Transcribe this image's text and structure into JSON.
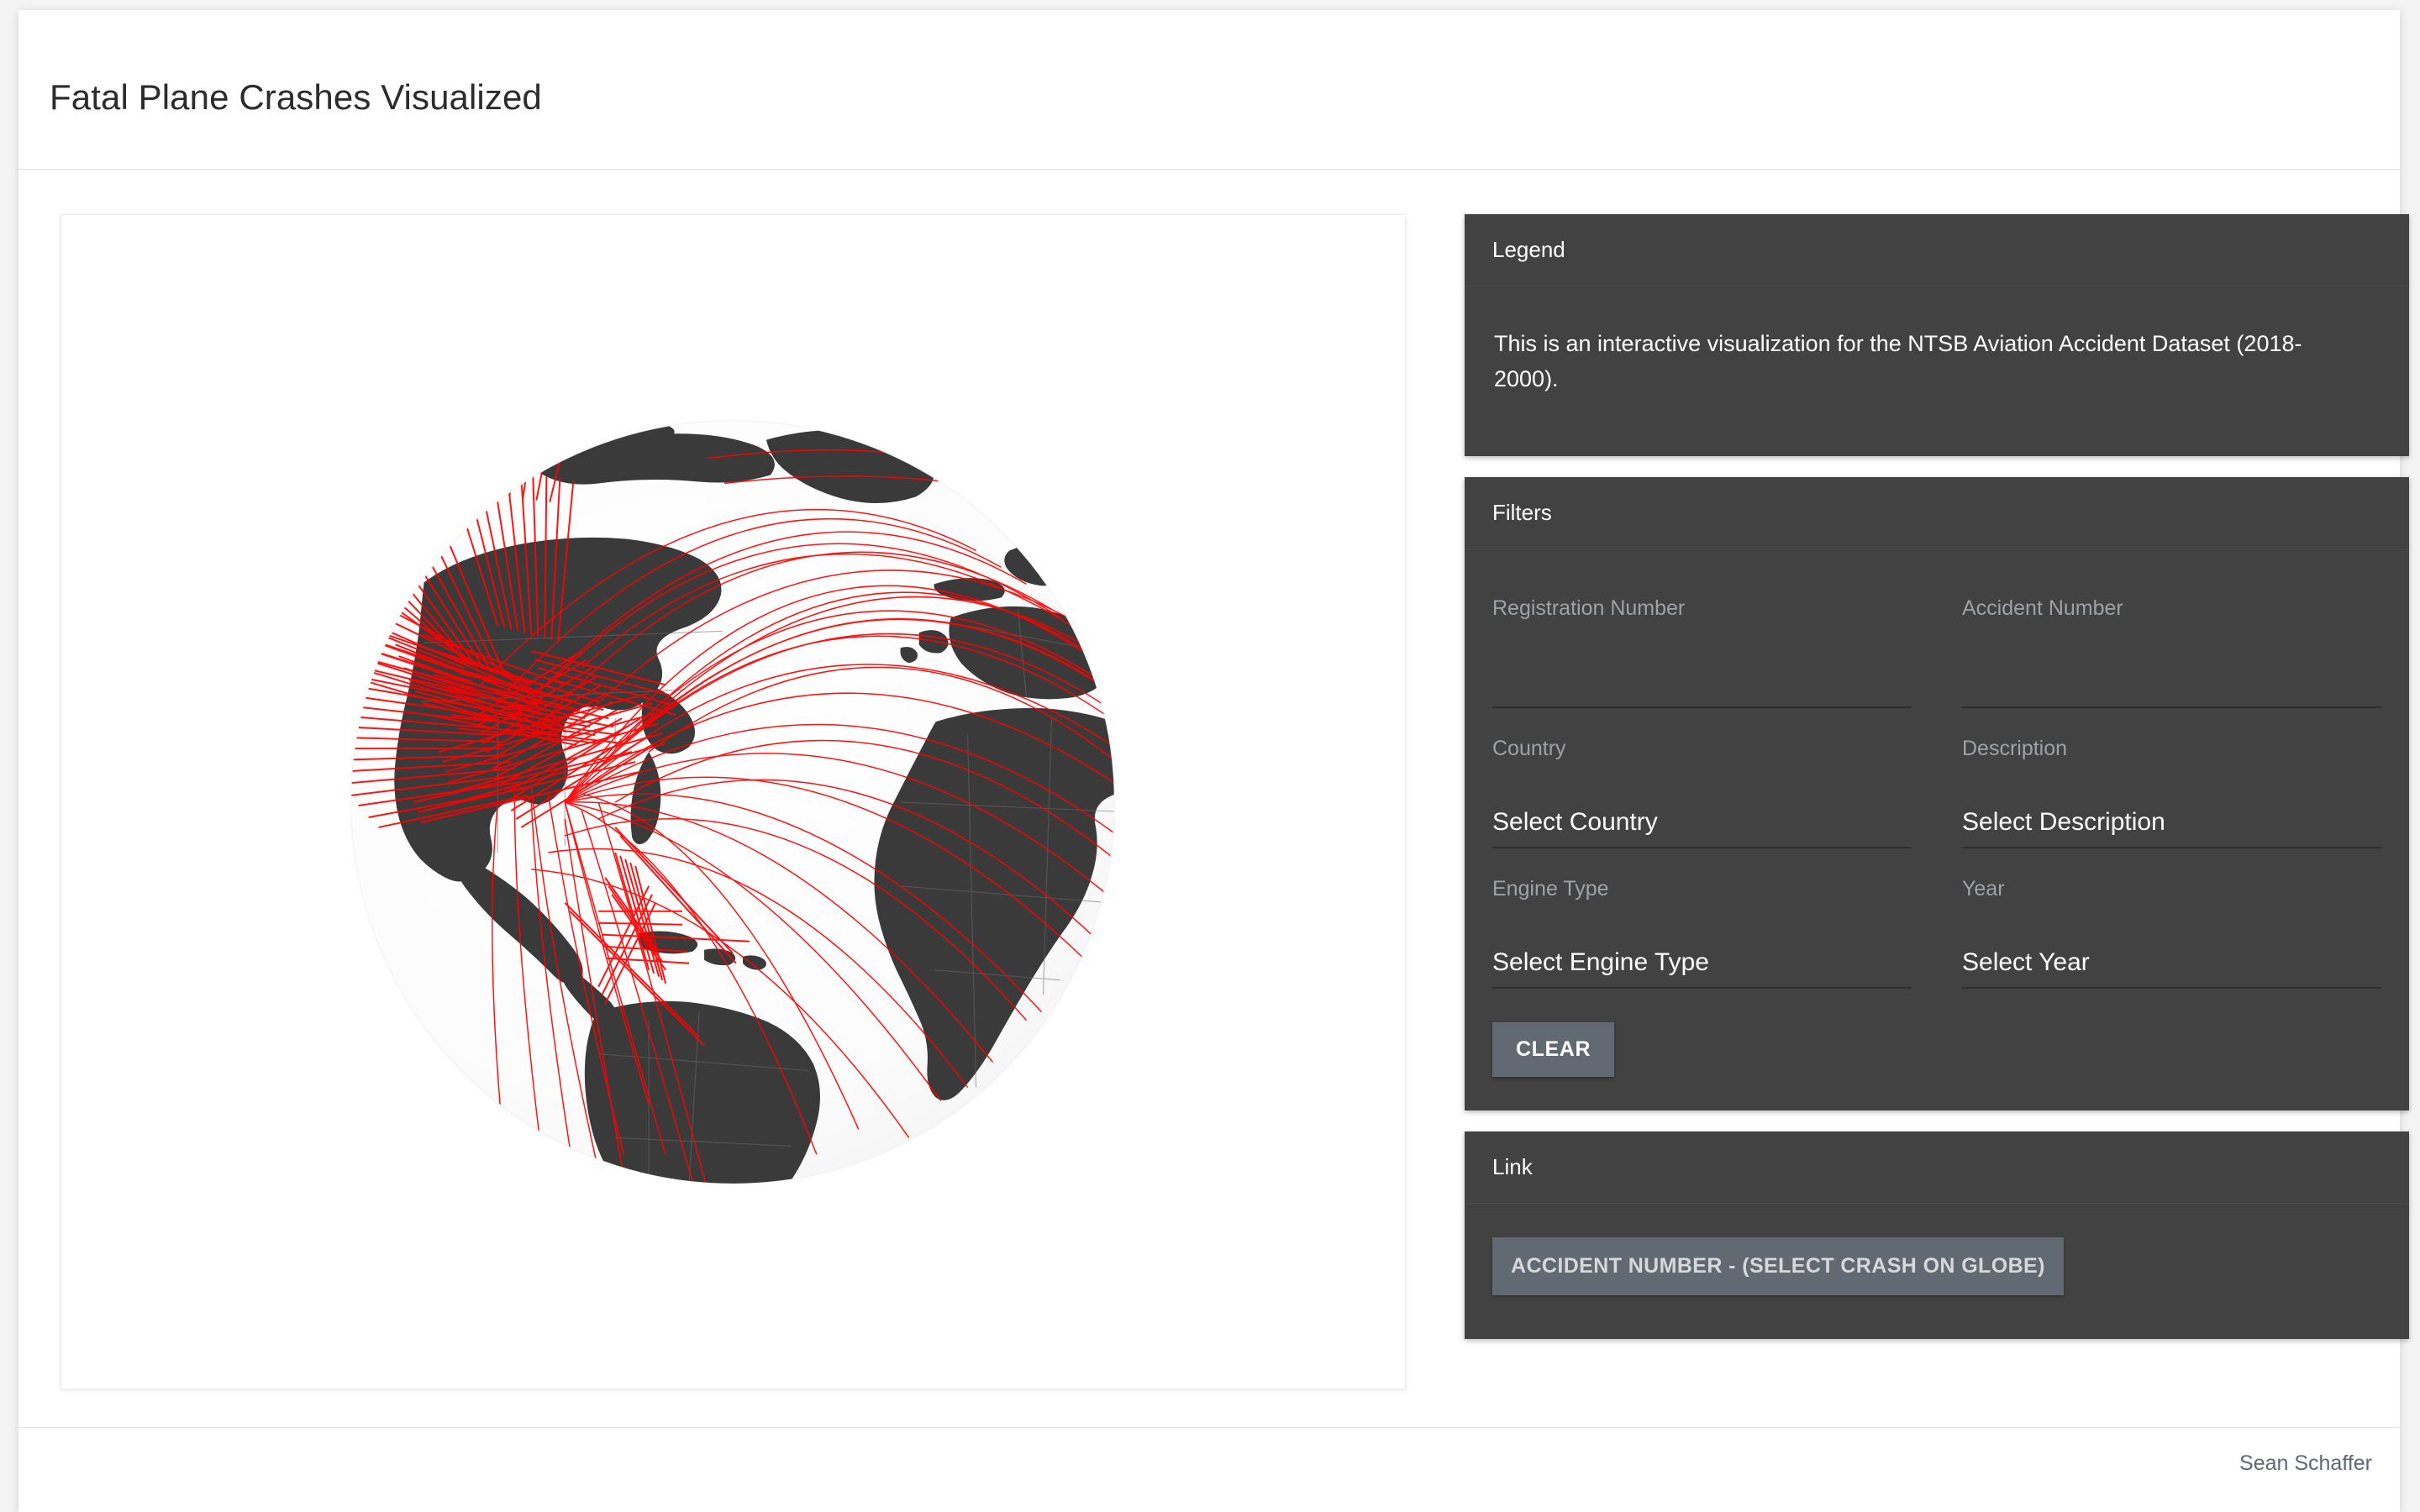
{
  "header": {
    "title": "Fatal Plane Crashes Visualized"
  },
  "legend": {
    "panel_title": "Legend",
    "text": "This is an interactive visualization for the NTSB Aviation Accident Dataset (2018-2000)."
  },
  "filters": {
    "panel_title": "Filters",
    "fields": [
      {
        "label": "Registration Number",
        "value": "",
        "placeholder": "",
        "kind": "text"
      },
      {
        "label": "Accident Number",
        "value": "",
        "placeholder": "",
        "kind": "text"
      },
      {
        "label": "Country",
        "value": "Select Country",
        "kind": "select"
      },
      {
        "label": "Description",
        "value": "Select Description",
        "kind": "select"
      },
      {
        "label": "Engine Type",
        "value": "Select Engine Type",
        "kind": "select"
      },
      {
        "label": "Year",
        "value": "Select Year",
        "kind": "select"
      }
    ],
    "clear_label": "CLEAR"
  },
  "link": {
    "panel_title": "Link",
    "button_label": "ACCIDENT NUMBER - (SELECT CRASH ON GLOBE)"
  },
  "footer": {
    "credit": "Sean Schaffer"
  },
  "globe": {
    "name": "orthographic-globe-visualization",
    "land_color": "#3a3a3a",
    "ocean_color": "#fbfbfb",
    "arc_color": "#ff0000",
    "border_color": "#6b6b6b",
    "centered_on": "Atlantic Ocean",
    "arc_cluster_region": "North America / United States"
  },
  "colors": {
    "page_background": "#f4f4f4",
    "card_background": "#ffffff",
    "panel_background": "#424242",
    "button_background": "#616a72",
    "title_text": "#2c2c2c",
    "label_text": "#9da2a8",
    "accent_red": "#ff0000"
  }
}
